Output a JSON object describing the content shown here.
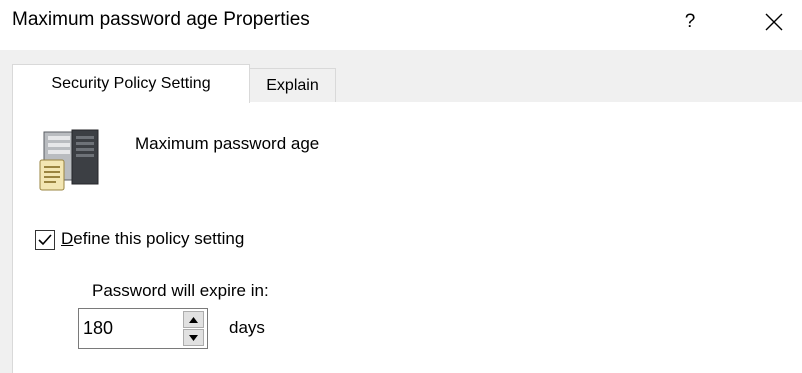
{
  "window": {
    "title": "Maximum password age Properties",
    "help_label": "?",
    "close_icon": "close-icon"
  },
  "tabs": [
    {
      "label": "Security Policy Setting",
      "active": true
    },
    {
      "label": "Explain",
      "active": false
    }
  ],
  "policy": {
    "icon": "server-policy-icon",
    "name": "Maximum password age"
  },
  "define_setting": {
    "label_accel": "D",
    "label_rest": "efine this policy setting",
    "checked": true
  },
  "expiry": {
    "label": "Password will expire in:",
    "value": "180",
    "units": "days"
  },
  "colors": {
    "dialog_background": "#f0f0f0",
    "panel_background": "#ffffff",
    "border": "#d9d9d9"
  }
}
